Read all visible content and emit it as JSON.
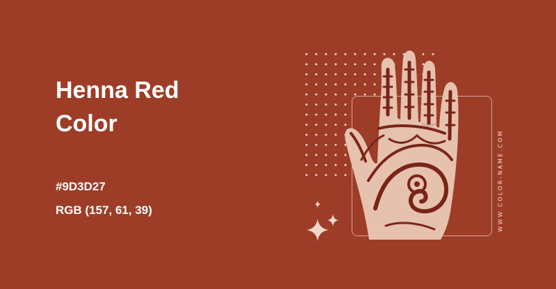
{
  "page": {
    "background": "#9D3D27"
  },
  "color_name": {
    "line1": "Henna Red",
    "line2": "Color"
  },
  "hex_code": "#9D3D27",
  "rgb_value": "RGB (157, 61, 39)",
  "image": {
    "subject": "hand with henna design",
    "skin_color": "#E6C1AE",
    "henna_color": "#7A2418"
  },
  "watermark": "WWW.COLOR-NAME.COM",
  "decorations": {
    "dot_color": "#F2D6CC",
    "sparkle_color": "#F2D6CC"
  }
}
